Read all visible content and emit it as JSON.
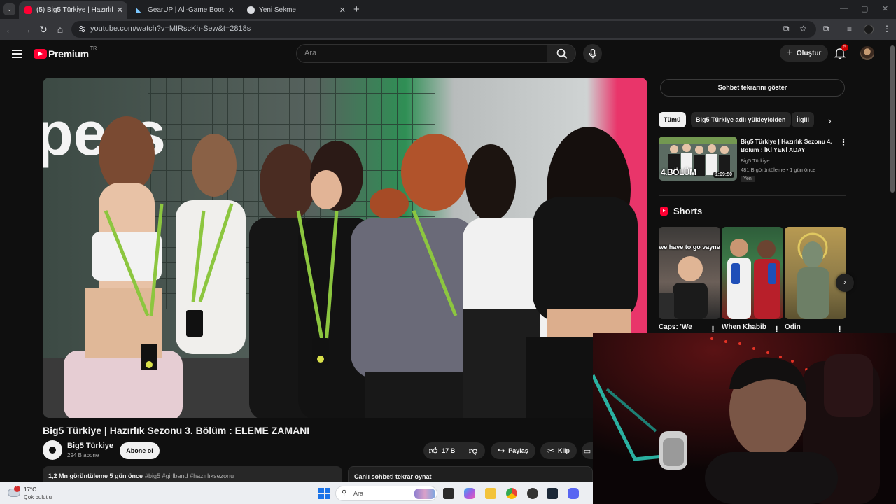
{
  "browser": {
    "tabs": [
      {
        "title": "(5) Big5 Türkiye | Hazırlık Sezonu",
        "active": true
      },
      {
        "title": "GearUP | All-Game Booster | Re",
        "active": false
      },
      {
        "title": "Yeni Sekme",
        "active": false
      }
    ],
    "url": "youtube.com/watch?v=MIRscKh-Sew&t=2818s"
  },
  "youtube": {
    "logo_text": "Premium",
    "country_code": "TR",
    "search_placeholder": "Ara",
    "create_label": "Oluştur",
    "notification_count": "5",
    "video": {
      "title": "Big5 Türkiye | Hazırlık Sezonu 3. Bölüm : ELEME ZAMANI",
      "channel": "Big5 Türkiye",
      "subscribers": "294 B abone",
      "subscribe_label": "Abone ol",
      "likes": "17 B",
      "share_label": "Paylaş",
      "clip_label": "Klip",
      "views_date": "1,2 Mn görüntüleme  5 gün önce",
      "tags": "#big5 #girlband #hazırlıksezonu",
      "chat_replay_label": "Canlı sohbeti tekrar oynat"
    },
    "sidebar": {
      "show_chat_label": "Sohbet tekrarını göster",
      "chips": [
        "Tümü",
        "Big5 Türkiye adlı yükleyiciden",
        "İlgili"
      ],
      "recommended": {
        "title": "Big5 Türkiye | Hazırlık Sezonu 4. Bölüm : İKİ YENİ ADAY",
        "channel": "Big5 Türkiye",
        "meta": "481 B görüntüleme • 1 gün önce",
        "badge": "Yeni",
        "duration": "1:09:50",
        "thumb_text": "4.BÖLÜM"
      },
      "shorts_heading": "Shorts",
      "shorts": [
        {
          "title": "Caps: 'We",
          "caption": "we have to go vayne"
        },
        {
          "title": "When Khabib",
          "caption": ""
        },
        {
          "title": "Odin",
          "caption": ""
        }
      ]
    }
  },
  "taskbar": {
    "temperature": "17°C",
    "condition": "Çok bulutlu",
    "weather_badge": "1",
    "search_placeholder": "Ara"
  }
}
